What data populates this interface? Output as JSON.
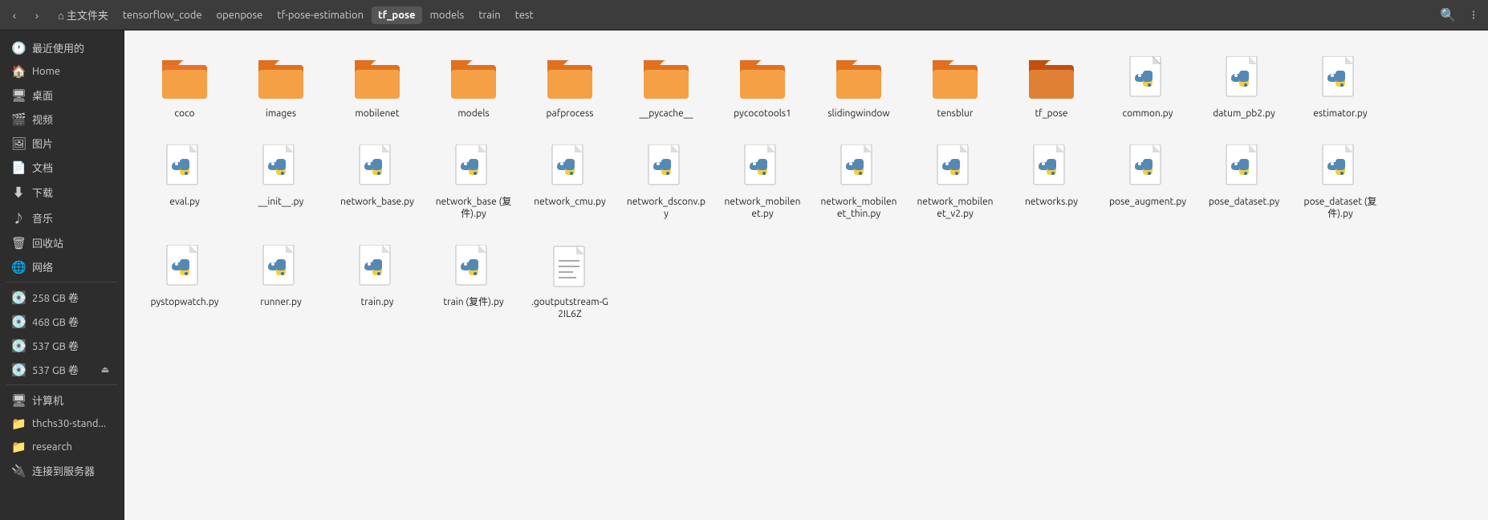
{
  "topbar": {
    "nav_back_label": "‹",
    "nav_forward_label": "›",
    "breadcrumbs": [
      {
        "label": "主文件夹",
        "id": "home",
        "active": false
      },
      {
        "label": "tensorflow_code",
        "id": "tensorflow_code",
        "active": false
      },
      {
        "label": "openpose",
        "id": "openpose",
        "active": false
      },
      {
        "label": "tf-pose-estimation",
        "id": "tf-pose-estimation",
        "active": false
      },
      {
        "label": "tf_pose",
        "id": "tf_pose",
        "active": true
      },
      {
        "label": "models",
        "id": "models",
        "active": false
      },
      {
        "label": "train",
        "id": "train",
        "active": false
      },
      {
        "label": "test",
        "id": "test",
        "active": false
      }
    ],
    "search_icon": "🔍",
    "view_icon": "⊞"
  },
  "sidebar": {
    "items": [
      {
        "id": "recent",
        "label": "最近使用的",
        "icon": "🕐",
        "active": false
      },
      {
        "id": "home",
        "label": "Home",
        "icon": "🏠",
        "active": false
      },
      {
        "id": "desktop",
        "label": "桌面",
        "icon": "🖥",
        "active": false
      },
      {
        "id": "videos",
        "label": "视频",
        "icon": "🎬",
        "active": false
      },
      {
        "id": "pictures",
        "label": "图片",
        "icon": "🖼",
        "active": false
      },
      {
        "id": "documents",
        "label": "文档",
        "icon": "📄",
        "active": false
      },
      {
        "id": "downloads",
        "label": "下载",
        "icon": "⬇",
        "active": false
      },
      {
        "id": "music",
        "label": "音乐",
        "icon": "♪",
        "active": false
      },
      {
        "id": "trash",
        "label": "回收站",
        "icon": "🗑",
        "active": false
      },
      {
        "id": "network",
        "label": "网络",
        "icon": "🌐",
        "active": false
      }
    ],
    "volumes": [
      {
        "id": "vol258",
        "label": "258 GB 卷",
        "icon": "💽",
        "eject": false
      },
      {
        "id": "vol468",
        "label": "468 GB 卷",
        "icon": "💽",
        "eject": false
      },
      {
        "id": "vol537a",
        "label": "537 GB 卷",
        "icon": "💽",
        "eject": false
      },
      {
        "id": "vol537b",
        "label": "537 GB 卷",
        "icon": "💽",
        "eject": true
      }
    ],
    "bookmarks": [
      {
        "id": "computer",
        "label": "计算机",
        "icon": "🖥"
      },
      {
        "id": "thchs30",
        "label": "thchs30-stand...",
        "icon": "📁"
      },
      {
        "id": "research",
        "label": "research",
        "icon": "📁"
      },
      {
        "id": "connect",
        "label": "连接到服务器",
        "icon": "🔌"
      }
    ]
  },
  "files": {
    "folders": [
      {
        "name": "coco",
        "type": "folder"
      },
      {
        "name": "images",
        "type": "folder"
      },
      {
        "name": "mobilenet",
        "type": "folder"
      },
      {
        "name": "models",
        "type": "folder"
      },
      {
        "name": "pafprocess",
        "type": "folder"
      },
      {
        "name": "__pycache__",
        "type": "folder"
      },
      {
        "name": "pycocotools1",
        "type": "folder"
      },
      {
        "name": "slidingwindow",
        "type": "folder"
      },
      {
        "name": "tensblur",
        "type": "folder"
      },
      {
        "name": "tf_pose",
        "type": "folder"
      }
    ],
    "python_files": [
      {
        "name": "common.py",
        "type": "python"
      },
      {
        "name": "datum_pb2.py",
        "type": "python"
      },
      {
        "name": "estimator.py",
        "type": "python"
      },
      {
        "name": "eval.py",
        "type": "python"
      },
      {
        "name": "__init__.py",
        "type": "python"
      },
      {
        "name": "network_base.py",
        "type": "python"
      },
      {
        "name": "network_base (复件).py",
        "type": "python"
      },
      {
        "name": "network_cmu.py",
        "type": "python"
      },
      {
        "name": "network_dsconv.py",
        "type": "python"
      },
      {
        "name": "network_mobilenet.py",
        "type": "python"
      },
      {
        "name": "network_mobilenet_thin.py",
        "type": "python"
      },
      {
        "name": "network_mobilenet_v2.py",
        "type": "python"
      },
      {
        "name": "networks.py",
        "type": "python"
      },
      {
        "name": "pose_augment.py",
        "type": "python"
      },
      {
        "name": "pose_dataset.py",
        "type": "python"
      },
      {
        "name": "pose_dataset (复件).py",
        "type": "python"
      },
      {
        "name": "pystopwatch.py",
        "type": "python"
      },
      {
        "name": "runner.py",
        "type": "python"
      },
      {
        "name": "train.py",
        "type": "python"
      },
      {
        "name": "train (复件).py",
        "type": "python"
      }
    ],
    "other_files": [
      {
        "name": ".goutputstream-G2IL6Z",
        "type": "text"
      }
    ]
  },
  "accent_color": "#4a6fa5"
}
